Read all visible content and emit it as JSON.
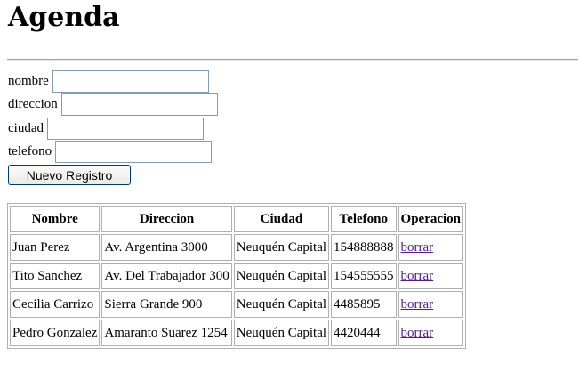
{
  "page": {
    "title": "Agenda"
  },
  "form": {
    "fields": [
      {
        "label": "nombre",
        "value": ""
      },
      {
        "label": "direccion",
        "value": ""
      },
      {
        "label": "ciudad",
        "value": ""
      },
      {
        "label": "telefono",
        "value": ""
      }
    ],
    "submit_label": "Nuevo Registro"
  },
  "table": {
    "headers": [
      "Nombre",
      "Direccion",
      "Ciudad",
      "Telefono",
      "Operacion"
    ],
    "rows": [
      {
        "nombre": "Juan Perez",
        "direccion": "Av. Argentina 3000",
        "ciudad": "Neuquén Capital",
        "telefono": "154888888",
        "operacion": "borrar"
      },
      {
        "nombre": "Tito Sanchez",
        "direccion": "Av. Del Trabajador 300",
        "ciudad": "Neuquén Capital",
        "telefono": "154555555",
        "operacion": "borrar"
      },
      {
        "nombre": "Cecilia Carrizo",
        "direccion": "Sierra Grande 900",
        "ciudad": "Neuquén Capital",
        "telefono": "4485895",
        "operacion": "borrar"
      },
      {
        "nombre": "Pedro Gonzalez",
        "direccion": "Amaranto Suarez 1254",
        "ciudad": "Neuquén Capital",
        "telefono": "4420444",
        "operacion": "borrar"
      }
    ]
  },
  "colors": {
    "link_visited": "#551a8b",
    "input_border": "#7f9db9",
    "table_border": "#b0b0b0"
  }
}
